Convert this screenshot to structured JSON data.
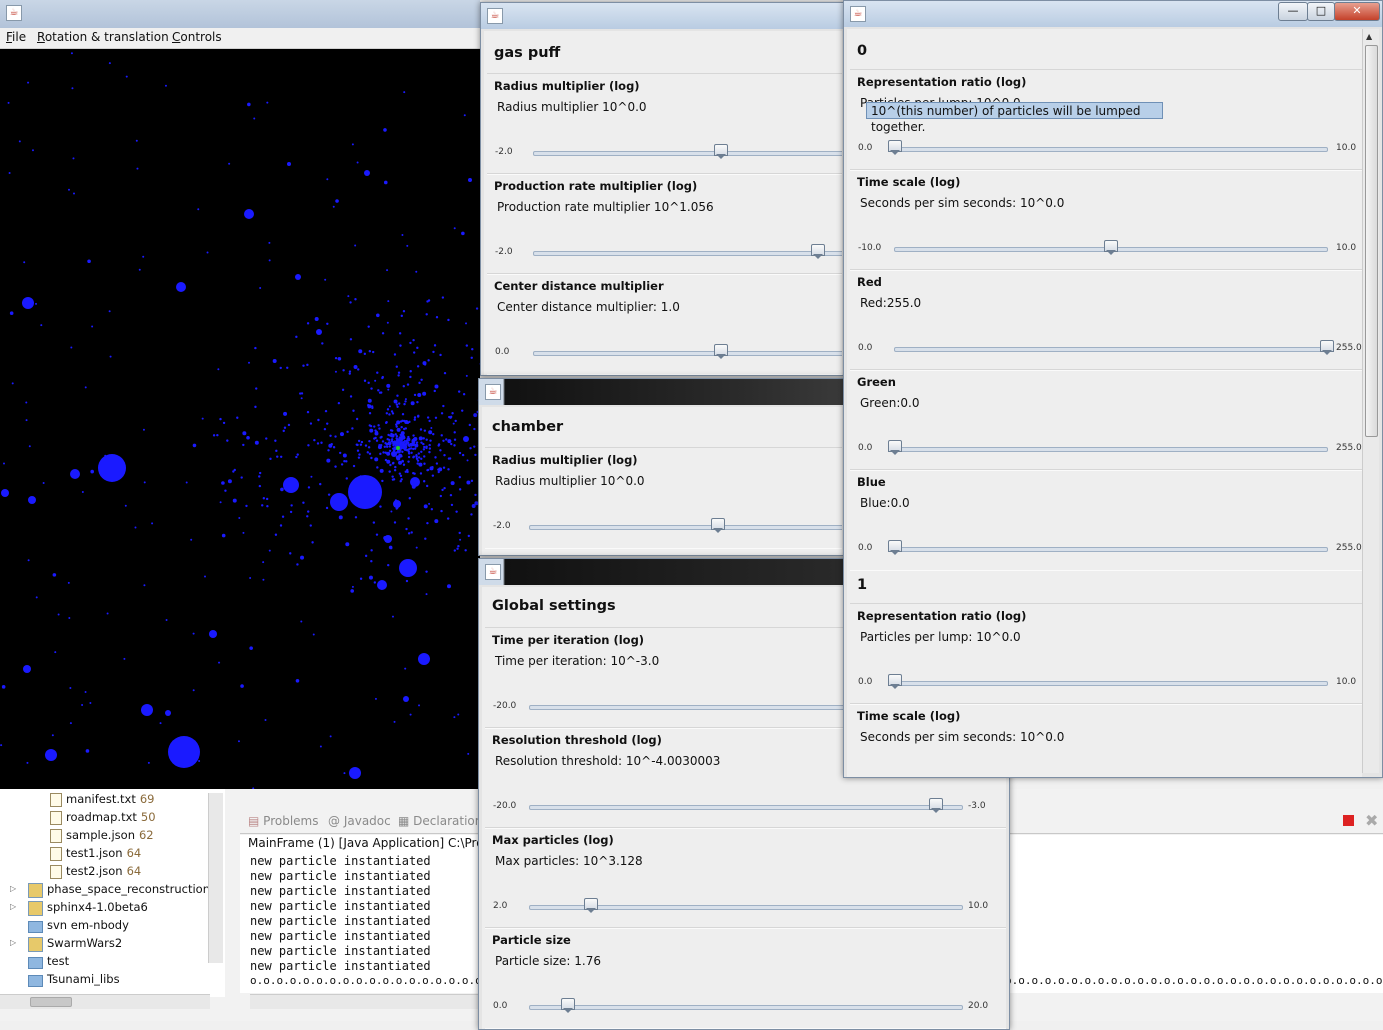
{
  "main": {
    "menus": [
      "File",
      "Rotation & translation",
      "Controls"
    ]
  },
  "gas_puff_window": {
    "group": "gas puff",
    "params": [
      {
        "title": "Radius multiplier (log)",
        "value": "Radius multiplier 10^0.0",
        "min": "-2.0",
        "level": 0.5
      },
      {
        "title": "Production rate multiplier (log)",
        "value": "Production rate multiplier 10^1.056",
        "min": "-2.0",
        "level": 0.76
      },
      {
        "title": "Center distance multiplier",
        "value": "Center distance multiplier: 1.0",
        "min": "0.0",
        "level": 0.5
      }
    ]
  },
  "chamber_window": {
    "group": "chamber",
    "params": [
      {
        "title": "Radius multiplier (log)",
        "value": "Radius multiplier 10^0.0",
        "min": "-2.0",
        "level": 0.5
      }
    ]
  },
  "global_window": {
    "group": "Global settings",
    "params": [
      {
        "title": "Time per iteration (log)",
        "value": "Time per iteration: 10^-3.0",
        "min": "-20.0",
        "max": "",
        "level": 0.9
      },
      {
        "title": "Resolution threshold (log)",
        "value": "Resolution threshold: 10^-4.0030003",
        "min": "-20.0",
        "max": "-3.0",
        "level": 0.94
      },
      {
        "title": "Max particles (log)",
        "value": "Max particles: 10^3.128",
        "min": "2.0",
        "max": "10.0",
        "level": 0.141
      },
      {
        "title": "Particle size",
        "value": "Particle size: 1.76",
        "min": "0.0",
        "max": "20.0",
        "level": 0.088
      }
    ]
  },
  "species_window": {
    "groups": [
      {
        "name": "0",
        "params": [
          {
            "title": "Representation ratio (log)",
            "value": "Particles per lump: 10^0.0",
            "min": "0.0",
            "max": "10.0",
            "level": 0.0
          },
          {
            "title": "Time scale (log)",
            "value": "Seconds per sim seconds: 10^0.0",
            "min": "-10.0",
            "max": "10.0",
            "level": 0.5
          },
          {
            "title": "Red",
            "value": "Red:255.0",
            "min": "0.0",
            "max": "255.0",
            "level": 1.0
          },
          {
            "title": "Green",
            "value": "Green:0.0",
            "min": "0.0",
            "max": "255.0",
            "level": 0.0
          },
          {
            "title": "Blue",
            "value": "Blue:0.0",
            "min": "0.0",
            "max": "255.0",
            "level": 0.0
          }
        ]
      },
      {
        "name": "1",
        "params": [
          {
            "title": "Representation ratio (log)",
            "value": "Particles per lump: 10^0.0",
            "min": "0.0",
            "max": "10.0",
            "level": 0.0
          },
          {
            "title": "Time scale (log)",
            "value": "Seconds per sim seconds: 10^0.0"
          }
        ]
      }
    ],
    "tooltip": "10^(this number) of particles will be lumped together.",
    "buttons": {
      "minimize": "—",
      "maximize": "□",
      "close": "✕"
    }
  },
  "eclipse": {
    "tree": [
      {
        "label": "manifest.txt",
        "num": "69",
        "kind": "file"
      },
      {
        "label": "roadmap.txt",
        "num": "50",
        "kind": "file"
      },
      {
        "label": "sample.json",
        "num": "62",
        "kind": "file"
      },
      {
        "label": "test1.json",
        "num": "64",
        "kind": "file"
      },
      {
        "label": "test2.json",
        "num": "64",
        "kind": "file"
      },
      {
        "label": "phase_space_reconstruction",
        "num": "",
        "kind": "project"
      },
      {
        "label": "sphinx4-1.0beta6",
        "num": "",
        "kind": "project"
      },
      {
        "label": "svn em-nbody",
        "num": "",
        "kind": "folder"
      },
      {
        "label": "SwarmWars2",
        "num": "",
        "kind": "project"
      },
      {
        "label": "test",
        "num": "",
        "kind": "folder"
      },
      {
        "label": "Tsunami_libs",
        "num": "",
        "kind": "folder"
      }
    ],
    "tabs": [
      "Problems",
      "Javadoc",
      "Declaration"
    ],
    "console_header": "MainFrame (1) [Java Application] C:\\Progra",
    "console_lines": [
      "new particle instantiated",
      "new particle instantiated",
      "new particle instantiated",
      "new particle instantiated",
      "new particle instantiated",
      "new particle instantiated",
      "new particle instantiated",
      "new particle instantiated"
    ],
    "dots_line": "o.o.o.o.o.o.o.o.o.o.o.o.o.o.o.o.o.o.o.o.o.o.o.o.o.o.o.o.o.o.o.o.o.o.o.o.o.o.o.o.o.o.o.o.o.o.o.o.o.o.o.o.o.o.o.o.o.o.o.o.o.o.o.o.o.o.o.o.o.o.o.o.o.o.o.o.o.o.o.o.o.o.o.o.o.o.o.o.o.o.o.o.o.o.o.o.o.o.o.o.o.o.o.o.o.o.o.o.o.o.o.o.o.o.o.o.o.o.o.o.o.o.o.o.o.o.o.o.o.o.o.o.o.o.o.o.o.o.o.o.o.o.o.o.o.o.o.o.o.o.o.o.o.o.o.o.o.o"
  },
  "colors": {
    "particle": "#1a1aff",
    "canvas_bg": "#000000",
    "selected_particle": "#22cc22"
  }
}
